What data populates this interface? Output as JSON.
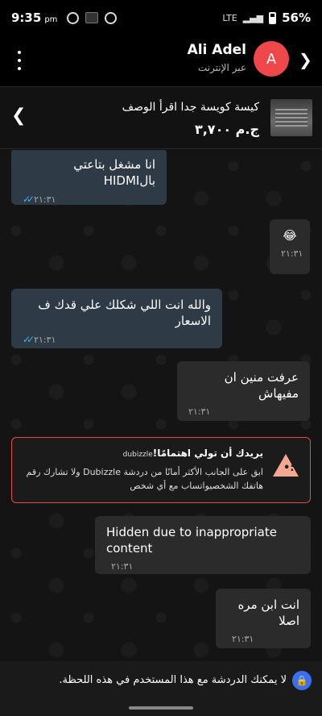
{
  "status_bar": {
    "time": "9:35",
    "ampm": "pm",
    "battery": "56%",
    "network": "LTE"
  },
  "header": {
    "user_name": "Ali Adel",
    "user_status": "عبر الإنترنت",
    "avatar_letter": "A"
  },
  "listing": {
    "title": "كيسة كويسة جدا اقرأ الوصف",
    "price": "ج.م ٣,٧٠٠"
  },
  "messages": [
    {
      "text": "انا مشغل بتاعتي بالHIDMI",
      "time": "٢١:٣١",
      "mine": true
    },
    {
      "text": "😂",
      "time": "٢١:٣١",
      "mine": false
    },
    {
      "text": "والله انت اللي شكلك علي قدك ف الاسعار",
      "time": "٢١:٣١",
      "mine": true
    },
    {
      "text": "عرفت منين ان مفيهاش",
      "time": "٢١:٣١",
      "mine": false
    },
    {
      "text": "Hidden due to inappropriate content",
      "time": "٢١:٣١",
      "mine": false
    },
    {
      "text": "انت ابن مره اصلا",
      "time": "٢١:٣١",
      "mine": false
    }
  ],
  "warning": {
    "brand": "dubizzle",
    "title": "يريدك أن تولي اهتمامًا!",
    "body": "ابق على الجانب الأكثر أمانًا من دردشة Dubizzle ولا تشارك رقم هاتفك الشخصيواتساب مع أي شخص"
  },
  "footer": {
    "text": "لا يمكنك الدردشة مع هذا المستخدم في هذه اللحظة."
  },
  "colors": {
    "accent_red": "#e5484d",
    "avatar": "#f0484a",
    "my_bubble": "#2e3a45",
    "their_bubble": "#2b2b2b",
    "tick_blue": "#3fb4f0"
  }
}
